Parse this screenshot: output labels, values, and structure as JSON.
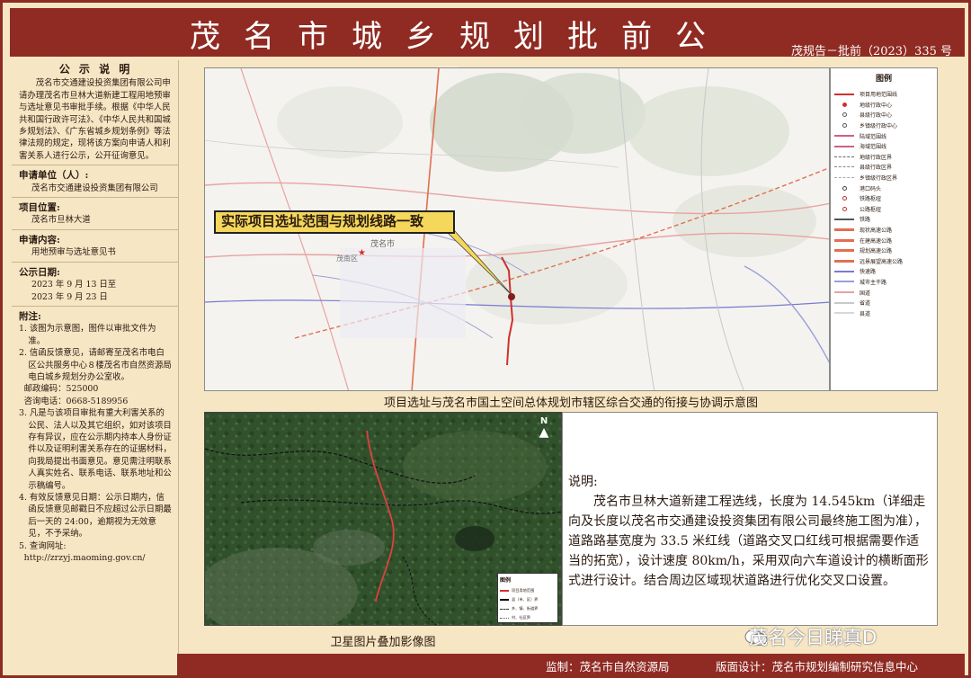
{
  "header": {
    "title": "茂名市城乡规划批前公示",
    "doc_no": "茂规告－批前（2023）335 号"
  },
  "notice": {
    "heading": "公 示 说 明",
    "intro": "茂名市交通建设投资集团有限公司申请办理茂名市旦林大道新建工程用地预审与选址意见书审批手续。根据《中华人民共和国行政许可法》、《中华人民共和国城乡规划法》、《广东省城乡规划条例》等法律法规的规定，现将该方案向申请人和利害关系人进行公示，公开征询意见。",
    "applicant_label": "申请单位（人）:",
    "applicant_value": "茂名市交通建设投资集团有限公司",
    "location_label": "项目位置:",
    "location_value": "茂名市旦林大道",
    "content_label": "申请内容:",
    "content_value": "用地预审与选址意见书",
    "date_label": "公示日期:",
    "date_from": "2023 年 9 月 13 日至",
    "date_to": "2023 年 9 月 23 日",
    "notes_label": "附注:",
    "notes": [
      "1. 该图为示意图，图件以审批文件为准。",
      "2. 信函反馈意见，请邮寄至茂名市电白区公共服务中心８楼茂名市自然资源局电白城乡规划分办公室收。",
      "3. 凡是与该项目审批有重大利害关系的公民、法人以及其它组织，如对该项目存有异议，应在公示期内持本人身份证件以及证明利害关系存在的证据材料，向我局提出书面意见。意见需注明联系人真实姓名、联系电话、联系地址和公示稿编号。",
      "4. 有效反馈意见日期：公示日期内，信函反馈意见邮戳日不应超过公示日期最后一天的 24:00，逾期视为无效意见，不予采纳。",
      "5. 查询网址:"
    ],
    "postcode": "邮政编码：525000",
    "phone": "咨询电话：0668-5189956",
    "url": "http://zrzyj.maoming.gov.cn/"
  },
  "map1": {
    "callout": "实际项目选址范围与规划线路一致",
    "caption": "项目选址与茂名市国土空间总体规划市辖区综合交通的衔接与协调示意图",
    "place_labels": [
      "茂名市",
      "茂南区"
    ]
  },
  "legend1": {
    "title": "图例",
    "items": [
      {
        "label": "项目用地范围线",
        "color": "#d0312d"
      },
      {
        "label": "地级行政中心",
        "color": "#d0312d"
      },
      {
        "label": "县级行政中心",
        "color": "#555555"
      },
      {
        "label": "乡镇级行政中心",
        "color": "#555555"
      },
      {
        "label": "陆域范围线",
        "color": "#d06080"
      },
      {
        "label": "海域范围线",
        "color": "#d06080"
      },
      {
        "label": "地级行政区界",
        "color": "#666666"
      },
      {
        "label": "县级行政区界",
        "color": "#888888"
      },
      {
        "label": "乡镇级行政区界",
        "color": "#aaaaaa"
      },
      {
        "label": "港口码头",
        "color": "#444444"
      },
      {
        "label": "铁路枢纽",
        "color": "#c03030"
      },
      {
        "label": "公路枢纽",
        "color": "#c03030"
      },
      {
        "label": "铁路",
        "color": "#555555"
      },
      {
        "label": "现状高速公路",
        "color": "#e07050"
      },
      {
        "label": "在建高速公路",
        "color": "#e07050"
      },
      {
        "label": "规划高速公路",
        "color": "#e07050"
      },
      {
        "label": "远景展望高速公路",
        "color": "#e07050"
      },
      {
        "label": "快速路",
        "color": "#7a7ad0"
      },
      {
        "label": "城市主干路",
        "color": "#9aa0d8"
      },
      {
        "label": "国道",
        "color": "#e8a3a0"
      },
      {
        "label": "省道",
        "color": "#c8c8c8"
      },
      {
        "label": "县道",
        "color": "#d8d8d8"
      }
    ]
  },
  "satellite": {
    "caption": "卫星图片叠加影像图",
    "north": "N",
    "legend_title": "图例",
    "legend_items": [
      "项目用地范围",
      "县（市、区）界",
      "乡、镇、街道界",
      "村、社区界"
    ]
  },
  "description": {
    "heading": "说明:",
    "body": "茂名市旦林大道新建工程选线，长度为 14.545km（详细走向及长度以茂名市交通建设投资集团有限公司最终施工图为准），道路路基宽度为 33.5 米红线（道路交叉口红线可根据需要作适当的拓宽），设计速度 80km/h，采用双向六车道设计的横断面形式进行设计。结合周边区域现状道路进行优化交叉口设置。"
  },
  "footer": {
    "supervisor": "监制：茂名市自然资源局",
    "designer": "版面设计：茂名市规划编制研究信息中心"
  },
  "watermark": "茂名今日睇真D"
}
